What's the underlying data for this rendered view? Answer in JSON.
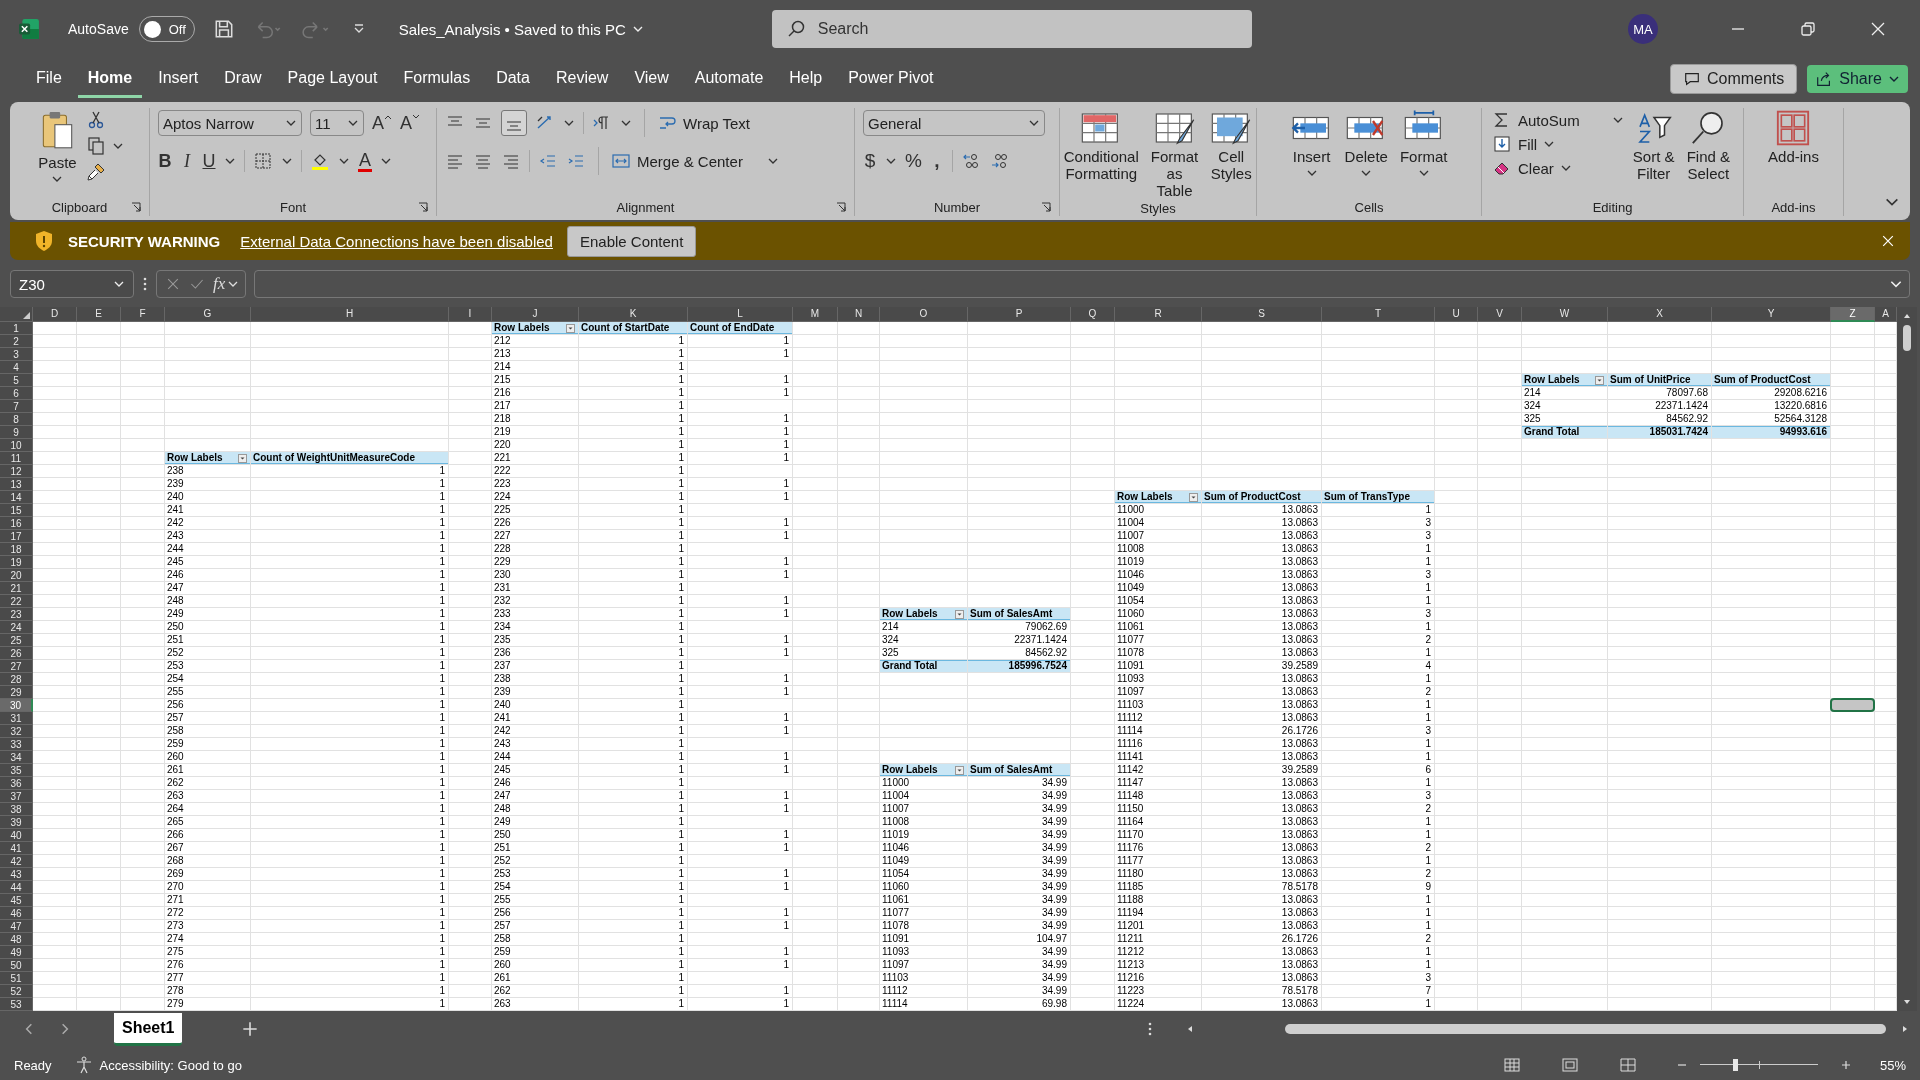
{
  "title_bar": {
    "autosave_label": "AutoSave",
    "autosave": {
      "on": false,
      "label": "Off"
    },
    "file_name": "Sales_Analysis",
    "separator": "•",
    "save_status": "Saved to this PC",
    "search_placeholder": "Search",
    "user_initials": "MA"
  },
  "menu_tabs": [
    {
      "label": "File",
      "selected": false
    },
    {
      "label": "Home",
      "selected": true
    },
    {
      "label": "Insert",
      "selected": false
    },
    {
      "label": "Draw",
      "selected": false
    },
    {
      "label": "Page Layout",
      "selected": false
    },
    {
      "label": "Formulas",
      "selected": false
    },
    {
      "label": "Data",
      "selected": false
    },
    {
      "label": "Review",
      "selected": false
    },
    {
      "label": "View",
      "selected": false
    },
    {
      "label": "Automate",
      "selected": false
    },
    {
      "label": "Help",
      "selected": false
    },
    {
      "label": "Power Pivot",
      "selected": false
    }
  ],
  "actions": {
    "comments": "Comments",
    "share": "Share"
  },
  "ribbon": {
    "clipboard": {
      "label": "Clipboard",
      "paste": "Paste"
    },
    "font": {
      "label": "Font",
      "font_name": "Aptos Narrow",
      "font_size": "11",
      "grow": "A",
      "shrink": "A",
      "bold": "B",
      "italic": "I",
      "underline": "U",
      "font_color": "A"
    },
    "alignment": {
      "label": "Alignment",
      "wrap_text": "Wrap Text",
      "merge_center": "Merge & Center"
    },
    "number": {
      "label": "Number",
      "format": "General",
      "currency": "$",
      "percent": "%",
      "comma": ","
    },
    "styles": {
      "label": "Styles",
      "buttons": [
        "Conditional\nFormatting",
        "Format as\nTable",
        "Cell\nStyles"
      ]
    },
    "cells": {
      "label": "Cells",
      "buttons": [
        "Insert",
        "Delete",
        "Format"
      ]
    },
    "editing": {
      "label": "Editing",
      "autosum": "AutoSum",
      "fill": "Fill",
      "clear": "Clear",
      "sort_filter": "Sort &\nFilter",
      "find_select": "Find &\nSelect"
    },
    "addins": {
      "label": "Add-ins",
      "button": "Add-ins"
    }
  },
  "security_bar": {
    "title": "SECURITY WARNING",
    "message": "External Data Connections have been disabled",
    "button": "Enable Content"
  },
  "formula_bar": {
    "name_box": "Z30",
    "function_label": "fx"
  },
  "sheet": {
    "columns": [
      "D",
      "E",
      "F",
      "G",
      "H",
      "I",
      "J",
      "K",
      "L",
      "M",
      "N",
      "O",
      "P",
      "Q",
      "R",
      "S",
      "T",
      "U",
      "V",
      "W",
      "X",
      "Y",
      "Z",
      "A"
    ],
    "rows": [
      {
        "number": "1",
        "cells": [
          null,
          null,
          null,
          null,
          null,
          null,
          {
            "text": "Row Labels",
            "kind": "header"
          },
          {
            "text": "Count of StartDate",
            "kind": "header"
          },
          {
            "text": "Count of EndDate",
            "kind": "header"
          }
        ]
      },
      {
        "number": "2",
        "cells": [
          null,
          null,
          null,
          null,
          null,
          null,
          "212",
          "1",
          "1"
        ]
      },
      {
        "number": "3",
        "cells": [
          null,
          null,
          null,
          null,
          null,
          null,
          "213",
          "1",
          "1"
        ]
      },
      {
        "number": "4",
        "cells": [
          null,
          null,
          null,
          null,
          null,
          null,
          "214",
          "1"
        ]
      },
      {
        "number": "5",
        "cells": [
          null,
          null,
          null,
          null,
          null,
          null,
          "215",
          "1",
          "1",
          null,
          null,
          null,
          null,
          null,
          null,
          null,
          null,
          null,
          null,
          {
            "text": "Row Labels",
            "kind": "header"
          },
          {
            "text": "Sum of UnitPrice",
            "kind": "header"
          },
          {
            "text": "Sum of ProductCost",
            "kind": "header"
          }
        ]
      },
      {
        "number": "6",
        "cells": [
          null,
          null,
          null,
          null,
          null,
          null,
          "216",
          "1",
          "1",
          null,
          null,
          null,
          null,
          null,
          null,
          null,
          null,
          null,
          null,
          "214",
          "78097.68",
          "29208.6216"
        ]
      },
      {
        "number": "7",
        "cells": [
          null,
          null,
          null,
          null,
          null,
          null,
          "217",
          "1",
          null,
          null,
          null,
          null,
          null,
          null,
          null,
          null,
          null,
          null,
          null,
          "324",
          "22371.1424",
          "13220.6816"
        ]
      },
      {
        "number": "8",
        "cells": [
          null,
          null,
          null,
          null,
          null,
          null,
          "218",
          "1",
          "1",
          null,
          null,
          null,
          null,
          null,
          null,
          null,
          null,
          null,
          null,
          "325",
          "84562.92",
          "52564.3128"
        ]
      },
      {
        "number": "9",
        "cells": [
          null,
          null,
          null,
          null,
          null,
          null,
          "219",
          "1",
          "1",
          null,
          null,
          null,
          null,
          null,
          null,
          null,
          null,
          null,
          null,
          {
            "text": "Grand Total",
            "kind": "total"
          },
          {
            "text": "185031.7424",
            "kind": "total"
          },
          {
            "text": "94993.616",
            "kind": "total"
          }
        ]
      },
      {
        "number": "10",
        "cells": [
          null,
          null,
          null,
          null,
          null,
          null,
          "220",
          "1",
          "1"
        ]
      },
      {
        "number": "11",
        "cells": [
          null,
          null,
          null,
          {
            "text": "Row Labels",
            "kind": "header"
          },
          {
            "text": "Count of WeightUnitMeasureCode",
            "kind": "header"
          },
          null,
          "221",
          "1",
          "1"
        ]
      },
      {
        "number": "12",
        "cells": [
          null,
          null,
          null,
          "238",
          "1",
          null,
          "222",
          "1"
        ]
      },
      {
        "number": "13",
        "cells": [
          null,
          null,
          null,
          "239",
          "1",
          null,
          "223",
          "1",
          "1"
        ]
      },
      {
        "number": "14",
        "cells": [
          null,
          null,
          null,
          "240",
          "1",
          null,
          "224",
          "1",
          "1",
          null,
          null,
          null,
          null,
          null,
          {
            "text": "Row Labels",
            "kind": "header"
          },
          {
            "text": "Sum of ProductCost",
            "kind": "header"
          },
          {
            "text": "Sum of TransType",
            "kind": "header"
          }
        ]
      },
      {
        "number": "15",
        "cells": [
          null,
          null,
          null,
          "241",
          "1",
          null,
          "225",
          "1",
          null,
          null,
          null,
          null,
          null,
          null,
          "11000",
          "13.0863",
          "1"
        ]
      },
      {
        "number": "16",
        "cells": [
          null,
          null,
          null,
          "242",
          "1",
          null,
          "226",
          "1",
          "1",
          null,
          null,
          null,
          null,
          null,
          "11004",
          "13.0863",
          "3"
        ]
      },
      {
        "number": "17",
        "cells": [
          null,
          null,
          null,
          "243",
          "1",
          null,
          "227",
          "1",
          "1",
          null,
          null,
          null,
          null,
          null,
          "11007",
          "13.0863",
          "3"
        ]
      },
      {
        "number": "18",
        "cells": [
          null,
          null,
          null,
          "244",
          "1",
          null,
          "228",
          "1",
          null,
          null,
          null,
          null,
          null,
          null,
          "11008",
          "13.0863",
          "1"
        ]
      },
      {
        "number": "19",
        "cells": [
          null,
          null,
          null,
          "245",
          "1",
          null,
          "229",
          "1",
          "1",
          null,
          null,
          null,
          null,
          null,
          "11019",
          "13.0863",
          "1"
        ]
      },
      {
        "number": "20",
        "cells": [
          null,
          null,
          null,
          "246",
          "1",
          null,
          "230",
          "1",
          "1",
          null,
          null,
          null,
          null,
          null,
          "11046",
          "13.0863",
          "3"
        ]
      },
      {
        "number": "21",
        "cells": [
          null,
          null,
          null,
          "247",
          "1",
          null,
          "231",
          "1",
          null,
          null,
          null,
          null,
          null,
          null,
          "11049",
          "13.0863",
          "1"
        ]
      },
      {
        "number": "22",
        "cells": [
          null,
          null,
          null,
          "248",
          "1",
          null,
          "232",
          "1",
          "1",
          null,
          null,
          null,
          null,
          null,
          "11054",
          "13.0863",
          "1"
        ]
      },
      {
        "number": "23",
        "cells": [
          null,
          null,
          null,
          "249",
          "1",
          null,
          "233",
          "1",
          "1",
          null,
          null,
          {
            "text": "Row Labels",
            "kind": "header"
          },
          {
            "text": "Sum of SalesAmt",
            "kind": "header"
          },
          null,
          "11060",
          "13.0863",
          "3"
        ]
      },
      {
        "number": "24",
        "cells": [
          null,
          null,
          null,
          "250",
          "1",
          null,
          "234",
          "1",
          null,
          null,
          null,
          "214",
          "79062.69",
          null,
          "11061",
          "13.0863",
          "1"
        ]
      },
      {
        "number": "25",
        "cells": [
          null,
          null,
          null,
          "251",
          "1",
          null,
          "235",
          "1",
          "1",
          null,
          null,
          "324",
          "22371.1424",
          null,
          "11077",
          "13.0863",
          "2"
        ]
      },
      {
        "number": "26",
        "cells": [
          null,
          null,
          null,
          "252",
          "1",
          null,
          "236",
          "1",
          "1",
          null,
          null,
          "325",
          "84562.92",
          null,
          "11078",
          "13.0863",
          "1"
        ]
      },
      {
        "number": "27",
        "cells": [
          null,
          null,
          null,
          "253",
          "1",
          null,
          "237",
          "1",
          null,
          null,
          null,
          {
            "text": "Grand Total",
            "kind": "total"
          },
          {
            "text": "185996.7524",
            "kind": "total"
          },
          null,
          "11091",
          "39.2589",
          "4"
        ]
      },
      {
        "number": "28",
        "cells": [
          null,
          null,
          null,
          "254",
          "1",
          null,
          "238",
          "1",
          "1",
          null,
          null,
          null,
          null,
          null,
          "11093",
          "13.0863",
          "1"
        ]
      },
      {
        "number": "29",
        "cells": [
          null,
          null,
          null,
          "255",
          "1",
          null,
          "239",
          "1",
          "1",
          null,
          null,
          null,
          null,
          null,
          "11097",
          "13.0863",
          "2"
        ]
      },
      {
        "number": "30",
        "cells": [
          null,
          null,
          null,
          "256",
          "1",
          null,
          "240",
          "1",
          null,
          null,
          null,
          null,
          null,
          null,
          "11103",
          "13.0863",
          "1",
          null,
          null,
          null,
          null,
          null,
          {
            "selected": true
          }
        ]
      },
      {
        "number": "31",
        "cells": [
          null,
          null,
          null,
          "257",
          "1",
          null,
          "241",
          "1",
          "1",
          null,
          null,
          null,
          null,
          null,
          "11112",
          "13.0863",
          "1"
        ]
      },
      {
        "number": "32",
        "cells": [
          null,
          null,
          null,
          "258",
          "1",
          null,
          "242",
          "1",
          "1",
          null,
          null,
          null,
          null,
          null,
          "11114",
          "26.1726",
          "3"
        ]
      },
      {
        "number": "33",
        "cells": [
          null,
          null,
          null,
          "259",
          "1",
          null,
          "243",
          "1",
          null,
          null,
          null,
          null,
          null,
          null,
          "11116",
          "13.0863",
          "1"
        ]
      },
      {
        "number": "34",
        "cells": [
          null,
          null,
          null,
          "260",
          "1",
          null,
          "244",
          "1",
          "1",
          null,
          null,
          null,
          null,
          null,
          "11141",
          "13.0863",
          "1"
        ]
      },
      {
        "number": "35",
        "cells": [
          null,
          null,
          null,
          "261",
          "1",
          null,
          "245",
          "1",
          "1",
          null,
          null,
          {
            "text": "Row Labels",
            "kind": "header"
          },
          {
            "text": "Sum of SalesAmt",
            "kind": "header"
          },
          null,
          "11142",
          "39.2589",
          "6"
        ]
      },
      {
        "number": "36",
        "cells": [
          null,
          null,
          null,
          "262",
          "1",
          null,
          "246",
          "1",
          null,
          null,
          null,
          "11000",
          "34.99",
          null,
          "11147",
          "13.0863",
          "1"
        ]
      },
      {
        "number": "37",
        "cells": [
          null,
          null,
          null,
          "263",
          "1",
          null,
          "247",
          "1",
          "1",
          null,
          null,
          "11004",
          "34.99",
          null,
          "11148",
          "13.0863",
          "3"
        ]
      },
      {
        "number": "38",
        "cells": [
          null,
          null,
          null,
          "264",
          "1",
          null,
          "248",
          "1",
          "1",
          null,
          null,
          "11007",
          "34.99",
          null,
          "11150",
          "13.0863",
          "2"
        ]
      },
      {
        "number": "39",
        "cells": [
          null,
          null,
          null,
          "265",
          "1",
          null,
          "249",
          "1",
          null,
          null,
          null,
          "11008",
          "34.99",
          null,
          "11164",
          "13.0863",
          "1"
        ]
      },
      {
        "number": "40",
        "cells": [
          null,
          null,
          null,
          "266",
          "1",
          null,
          "250",
          "1",
          "1",
          null,
          null,
          "11019",
          "34.99",
          null,
          "11170",
          "13.0863",
          "1"
        ]
      },
      {
        "number": "41",
        "cells": [
          null,
          null,
          null,
          "267",
          "1",
          null,
          "251",
          "1",
          "1",
          null,
          null,
          "11046",
          "34.99",
          null,
          "11176",
          "13.0863",
          "2"
        ]
      },
      {
        "number": "42",
        "cells": [
          null,
          null,
          null,
          "268",
          "1",
          null,
          "252",
          "1",
          null,
          null,
          null,
          "11049",
          "34.99",
          null,
          "11177",
          "13.0863",
          "1"
        ]
      },
      {
        "number": "43",
        "cells": [
          null,
          null,
          null,
          "269",
          "1",
          null,
          "253",
          "1",
          "1",
          null,
          null,
          "11054",
          "34.99",
          null,
          "11180",
          "13.0863",
          "2"
        ]
      },
      {
        "number": "44",
        "cells": [
          null,
          null,
          null,
          "270",
          "1",
          null,
          "254",
          "1",
          "1",
          null,
          null,
          "11060",
          "34.99",
          null,
          "11185",
          "78.5178",
          "9"
        ]
      },
      {
        "number": "45",
        "cells": [
          null,
          null,
          null,
          "271",
          "1",
          null,
          "255",
          "1",
          null,
          null,
          null,
          "11061",
          "34.99",
          null,
          "11188",
          "13.0863",
          "1"
        ]
      },
      {
        "number": "46",
        "cells": [
          null,
          null,
          null,
          "272",
          "1",
          null,
          "256",
          "1",
          "1",
          null,
          null,
          "11077",
          "34.99",
          null,
          "11194",
          "13.0863",
          "1"
        ]
      },
      {
        "number": "47",
        "cells": [
          null,
          null,
          null,
          "273",
          "1",
          null,
          "257",
          "1",
          "1",
          null,
          null,
          "11078",
          "34.99",
          null,
          "11201",
          "13.0863",
          "1"
        ]
      },
      {
        "number": "48",
        "cells": [
          null,
          null,
          null,
          "274",
          "1",
          null,
          "258",
          "1",
          null,
          null,
          null,
          "11091",
          "104.97",
          null,
          "11211",
          "26.1726",
          "2"
        ]
      },
      {
        "number": "49",
        "cells": [
          null,
          null,
          null,
          "275",
          "1",
          null,
          "259",
          "1",
          "1",
          null,
          null,
          "11093",
          "34.99",
          null,
          "11212",
          "13.0863",
          "1"
        ]
      },
      {
        "number": "50",
        "cells": [
          null,
          null,
          null,
          "276",
          "1",
          null,
          "260",
          "1",
          "1",
          null,
          null,
          "11097",
          "34.99",
          null,
          "11213",
          "13.0863",
          "1"
        ]
      },
      {
        "number": "51",
        "cells": [
          null,
          null,
          null,
          "277",
          "1",
          null,
          "261",
          "1",
          null,
          null,
          null,
          "11103",
          "34.99",
          null,
          "11216",
          "13.0863",
          "3"
        ]
      },
      {
        "number": "52",
        "cells": [
          null,
          null,
          null,
          "278",
          "1",
          null,
          "262",
          "1",
          "1",
          null,
          null,
          "11112",
          "34.99",
          null,
          "11223",
          "78.5178",
          "7"
        ]
      },
      {
        "number": "53",
        "cells": [
          null,
          null,
          null,
          "279",
          "1",
          null,
          "263",
          "1",
          "1",
          null,
          null,
          "11114",
          "69.98",
          null,
          "11224",
          "13.0863",
          "1"
        ]
      }
    ]
  },
  "sheet_tabs": [
    {
      "label": "Sheet1",
      "selected": true
    }
  ],
  "status_bar": {
    "status": "Ready",
    "accessibility": "Accessibility: Good to go",
    "zoom": "55%",
    "zoom_slider": {
      "level": 0.3
    }
  }
}
